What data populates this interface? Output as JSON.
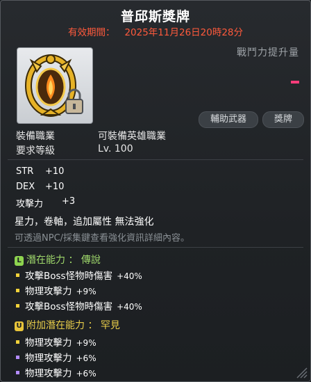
{
  "title": "普邱斯獎牌",
  "expiry": {
    "label": "有效期間：",
    "value": "2025年11月26日20時28分"
  },
  "icon": {
    "name": "medal-icon",
    "locked": true
  },
  "power": {
    "label": "戰鬥力提升量"
  },
  "tags": [
    "輔助武器",
    "獎牌"
  ],
  "requirements": [
    {
      "label": "裝備職業",
      "value": "可裝備英雄職業"
    },
    {
      "label": "要求等級",
      "value": "Lv. 100"
    }
  ],
  "stats": [
    {
      "name": "STR",
      "value": "+10"
    },
    {
      "name": "DEX",
      "value": "+10"
    },
    {
      "name": "攻擊力",
      "value": "+3"
    }
  ],
  "notice": {
    "line1": "星力，卷軸，追加屬性 無法強化",
    "line2": "可透過NPC/採集鍵查看強化資訊詳細內容。"
  },
  "potential": {
    "badge": "L",
    "title": "潛在能力 ： 傳說",
    "lines": [
      {
        "text": "攻擊Boss怪物時傷害",
        "value": "+40%"
      },
      {
        "text": "物理攻擊力",
        "value": "+9%"
      },
      {
        "text": "攻擊Boss怪物時傷害",
        "value": "+40%"
      }
    ]
  },
  "bonus_potential": {
    "badge": "U",
    "title": "附加潛在能力 ： 罕見",
    "lines": [
      {
        "text": "物理攻擊力",
        "value": "+9%",
        "color": "#f2d23a"
      },
      {
        "text": "物理攻擊力",
        "value": "+6%",
        "color": "#b38cff"
      },
      {
        "text": "物理攻擊力",
        "value": "+6%",
        "color": "#b38cff"
      }
    ]
  },
  "colors": {
    "title": "#ffffff",
    "expiry": "#ff5a3c",
    "legendary": "#9fd86b",
    "rare": "#e8cd4a",
    "power_mark": "#ff3c7a"
  }
}
